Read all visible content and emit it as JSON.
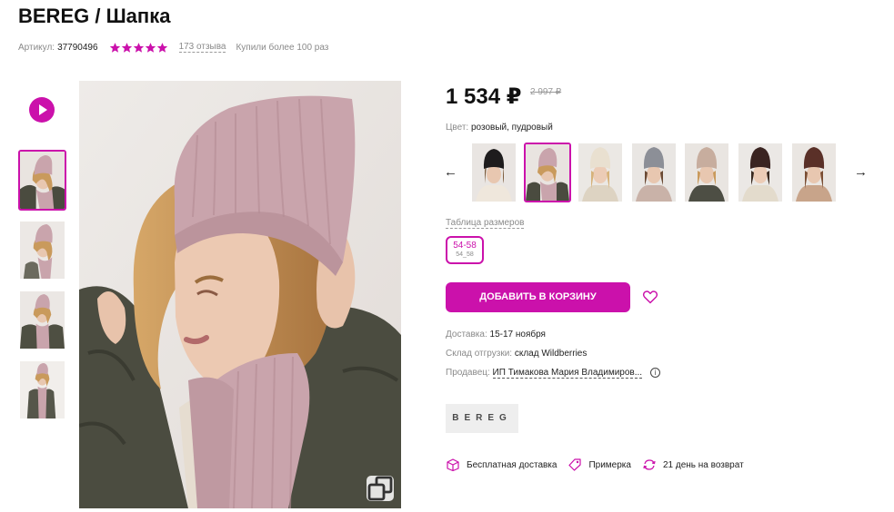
{
  "product": {
    "title": "BEREG / Шапка",
    "article_label": "Артикул:",
    "article": "37790496",
    "rating": 5,
    "reviews": "173 отзыва",
    "bought": "Купили более 100 раз"
  },
  "gallery": {
    "play": "play-video",
    "zoom": "zoom-icon"
  },
  "price": {
    "current": "1 534 ₽",
    "old": "2 997 ₽"
  },
  "color": {
    "label": "Цвет:",
    "value": "розовый, пудровый"
  },
  "sizes": {
    "table_link": "Таблица размеров",
    "selected": "54-58",
    "selected_sub": "54_58"
  },
  "actions": {
    "add_to_cart": "ДОБАВИТЬ В КОРЗИНУ"
  },
  "info": {
    "delivery_label": "Доставка:",
    "delivery_value": "15-17 ноября",
    "warehouse_label": "Склад отгрузки:",
    "warehouse_value": "склад Wildberries",
    "seller_label": "Продавец:",
    "seller_value": "ИП Тимакова Мария Владимиров..."
  },
  "brand": {
    "logo_text": "BEREG"
  },
  "features": [
    {
      "label": "Бесплатная доставка",
      "icon": "box-icon"
    },
    {
      "label": "Примерка",
      "icon": "tag-icon"
    },
    {
      "label": "21 день на возврат",
      "icon": "return-icon"
    }
  ],
  "colors": {
    "accent": "#cb11ab",
    "hat_pink": "#c9a4ac",
    "hat_black": "#1e1c1d",
    "hat_cream": "#e9e0d0",
    "hat_grey": "#8c8f97",
    "hat_beige": "#c7ad9e",
    "hat_darkbrown": "#3a2421",
    "hat_brown": "#5a3028"
  }
}
